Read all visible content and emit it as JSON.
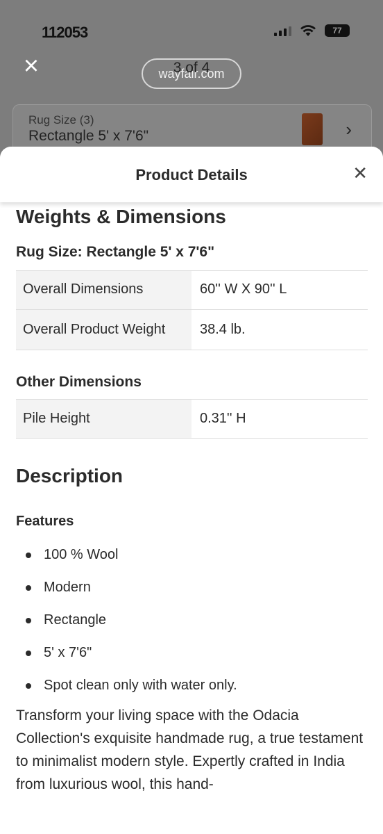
{
  "status": {
    "time": "112053",
    "battery": "77"
  },
  "browser": {
    "site": "wayfair.com",
    "pager": "3 of 4"
  },
  "background_card": {
    "label": "Rug Size (3)",
    "value": "Rectangle 5' x 7'6\""
  },
  "sheet": {
    "title": "Product Details"
  },
  "weights": {
    "heading": "Weights & Dimensions",
    "size_heading": "Rug Size: Rectangle 5' x 7'6\"",
    "rows": [
      {
        "label": "Overall Dimensions",
        "value": "60'' W X 90'' L"
      },
      {
        "label": "Overall Product Weight",
        "value": "38.4 lb."
      }
    ]
  },
  "other": {
    "heading": "Other Dimensions",
    "rows": [
      {
        "label": "Pile Height",
        "value": "0.31'' H"
      }
    ]
  },
  "description": {
    "heading": "Description",
    "features_heading": "Features",
    "features": [
      "100 % Wool",
      "Modern",
      "Rectangle",
      "5' x 7'6\"",
      "Spot clean only with water only."
    ],
    "paragraph": "Transform your living space with the Odacia Collection's exquisite handmade rug, a true testament to minimalist modern style. Expertly crafted in India from luxurious wool, this hand-"
  }
}
